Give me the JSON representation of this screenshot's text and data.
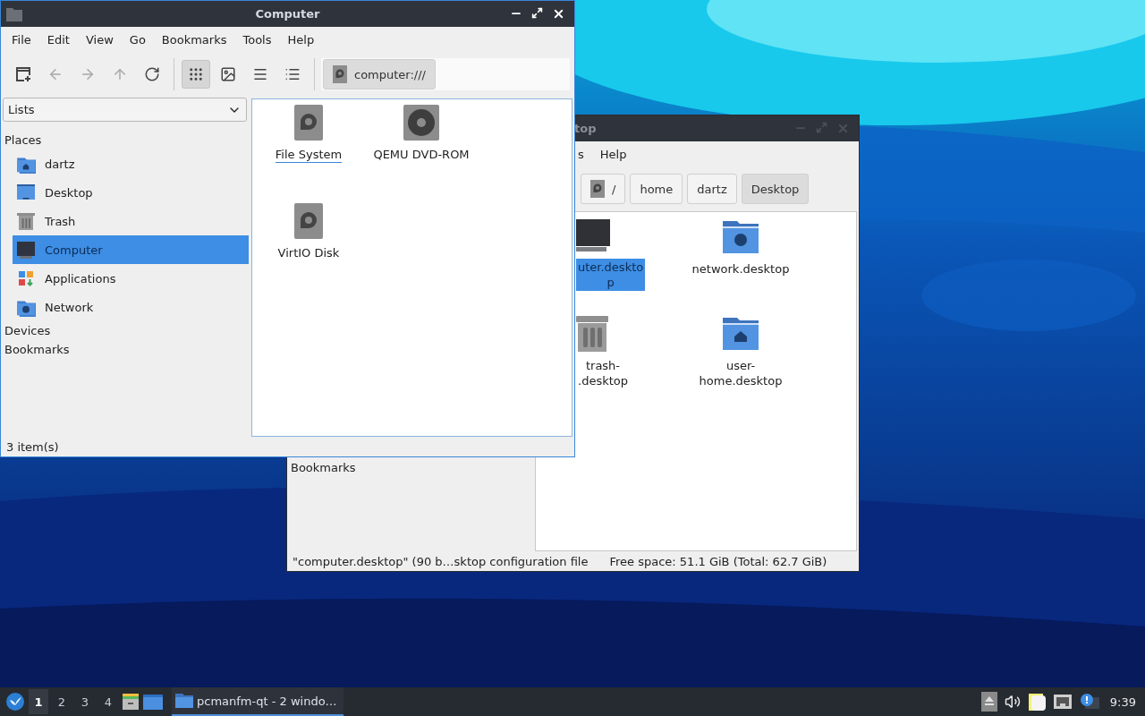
{
  "back_window": {
    "title": "top",
    "menu": [
      "s",
      "Help"
    ],
    "breadcrumbs": [
      {
        "label": "/",
        "kind": "root",
        "selected": false
      },
      {
        "label": "home",
        "kind": "dir",
        "selected": false
      },
      {
        "label": "dartz",
        "kind": "dir",
        "selected": false
      },
      {
        "label": "Desktop",
        "kind": "dir",
        "selected": true
      }
    ],
    "sidebar_sections": [
      "Bookmarks"
    ],
    "items": [
      {
        "lines": [
          "uter.deskto",
          "p"
        ],
        "kind": "computer",
        "selected": true
      },
      {
        "lines": [
          "network.desktop"
        ],
        "kind": "network-folder",
        "selected": false
      },
      {
        "lines": [
          "trash-",
          ".desktop"
        ],
        "kind": "trash",
        "selected": false
      },
      {
        "lines": [
          "user-",
          "home.desktop"
        ],
        "kind": "home-folder",
        "selected": false
      }
    ],
    "status": [
      "\"computer.desktop\" (90 b…sktop configuration file",
      "Free space: 51.1 GiB (Total: 62.7 GiB)"
    ]
  },
  "front_window": {
    "title": "Computer",
    "menu": [
      "File",
      "Edit",
      "View",
      "Go",
      "Bookmarks",
      "Tools",
      "Help"
    ],
    "nav_buttons": [
      {
        "kind": "new-window",
        "disabled": false
      },
      {
        "kind": "back",
        "disabled": true
      },
      {
        "kind": "forward",
        "disabled": true
      },
      {
        "kind": "up",
        "disabled": true
      },
      {
        "kind": "reload",
        "disabled": false
      }
    ],
    "view_buttons": [
      {
        "kind": "icons",
        "selected": true
      },
      {
        "kind": "thumbnails",
        "selected": false
      },
      {
        "kind": "compact",
        "selected": false
      },
      {
        "kind": "details",
        "selected": false
      }
    ],
    "address": "computer:///",
    "sidebar": {
      "dropdown": "Lists",
      "sections": [
        {
          "title": "Places",
          "items": [
            {
              "label": "dartz",
              "kind": "home-folder",
              "selected": false
            },
            {
              "label": "Desktop",
              "kind": "desktop",
              "selected": false
            },
            {
              "label": "Trash",
              "kind": "trash",
              "selected": false
            },
            {
              "label": "Computer",
              "kind": "computer",
              "selected": true
            },
            {
              "label": "Applications",
              "kind": "applications",
              "selected": false
            },
            {
              "label": "Network",
              "kind": "network-folder",
              "selected": false
            }
          ]
        },
        {
          "title": "Devices"
        },
        {
          "title": "Bookmarks"
        }
      ]
    },
    "items": [
      {
        "label": "File System",
        "kind": "drive",
        "focused": true
      },
      {
        "label": "QEMU DVD-ROM",
        "kind": "disc",
        "focused": false
      },
      {
        "label": "VirtIO Disk",
        "kind": "drive",
        "focused": false
      }
    ],
    "status": "3 item(s)"
  },
  "taskbar": {
    "desktops": [
      {
        "label": "1",
        "selected": true
      },
      {
        "label": "2",
        "selected": false
      },
      {
        "label": "3",
        "selected": false
      },
      {
        "label": "4",
        "selected": false
      }
    ],
    "task": "pcmanfm-qt - 2 windo…",
    "clock": "9:39"
  }
}
